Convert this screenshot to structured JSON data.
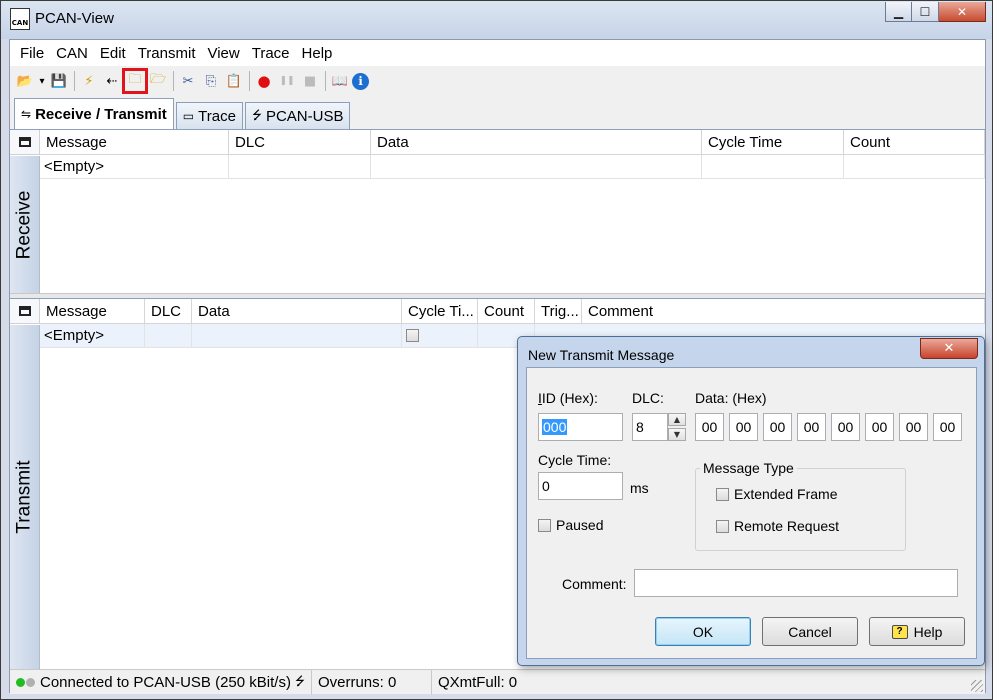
{
  "window": {
    "title": "PCAN-View",
    "icon_text": "CAN",
    "buttons": [
      "minimize-icon",
      "maximize-icon",
      "close-icon"
    ]
  },
  "menu": [
    "File",
    "CAN",
    "Edit",
    "Transmit",
    "View",
    "Trace",
    "Help"
  ],
  "toolbar": {
    "items": [
      {
        "name": "open-icon",
        "glyph": "📂"
      },
      {
        "name": "dropdown-arrow-icon",
        "glyph": "▾"
      },
      {
        "name": "save-icon",
        "glyph": "💾"
      },
      {
        "name": "connect-icon",
        "glyph": "⚡"
      },
      {
        "name": "disconnect-icon",
        "glyph": "⇠"
      },
      {
        "name": "load-transmit-list-icon",
        "glyph": "🗀",
        "selected": true
      },
      {
        "name": "save-transmit-list-icon",
        "glyph": "🗁"
      },
      {
        "name": "cut-icon",
        "glyph": "✂"
      },
      {
        "name": "copy-icon",
        "glyph": "⎘"
      },
      {
        "name": "paste-icon",
        "glyph": "📋"
      },
      {
        "name": "record-icon",
        "glyph": "●"
      },
      {
        "name": "pause-icon",
        "glyph": "❚❚"
      },
      {
        "name": "stop-icon",
        "glyph": "■"
      },
      {
        "name": "manual-icon",
        "glyph": "📖"
      },
      {
        "name": "info-icon",
        "glyph": "ℹ"
      }
    ]
  },
  "tabs": [
    {
      "label": "Receive / Transmit",
      "icon": "receive-transmit-icon",
      "glyph": "⇋",
      "active": true
    },
    {
      "label": "Trace",
      "icon": "trace-icon",
      "glyph": "▭"
    },
    {
      "label": "PCAN-USB",
      "icon": "usb-icon",
      "glyph": "⭍"
    }
  ],
  "receive": {
    "side_label": "Receive",
    "columns": [
      "Message",
      "DLC",
      "Data",
      "Cycle Time",
      "Count"
    ],
    "rows": [
      [
        "<Empty>",
        "",
        "",
        "",
        ""
      ]
    ]
  },
  "transmit": {
    "side_label": "Transmit",
    "columns": [
      "Message",
      "DLC",
      "Data",
      "Cycle Ti...",
      "Count",
      "Trig...",
      "Comment"
    ],
    "rows": [
      [
        "<Empty>",
        "",
        "",
        "",
        "",
        "",
        ""
      ]
    ]
  },
  "status": {
    "connection": "Connected to PCAN-USB (250 kBit/s)",
    "overruns": "Overruns: 0",
    "qxmtfull": "QXmtFull: 0",
    "led_colors": [
      "#22bb22",
      "#b0b0b0"
    ]
  },
  "dialog": {
    "title": "New Transmit Message",
    "close_label": "x",
    "id_label": "ID (Hex):",
    "id_value": "000",
    "dlc_label": "DLC:",
    "dlc_value": "8",
    "data_label": "Data: (Hex)",
    "data_bytes": [
      "00",
      "00",
      "00",
      "00",
      "00",
      "00",
      "00",
      "00"
    ],
    "cycle_label": "Cycle Time:",
    "cycle_value": "0",
    "cycle_unit": "ms",
    "paused_label": "Paused",
    "message_type_title": "Message Type",
    "extended_label": "Extended Frame",
    "remote_label": "Remote Request",
    "comment_label": "Comment:",
    "comment_value": "",
    "ok_label": "OK",
    "cancel_label": "Cancel",
    "help_label": "Help"
  }
}
